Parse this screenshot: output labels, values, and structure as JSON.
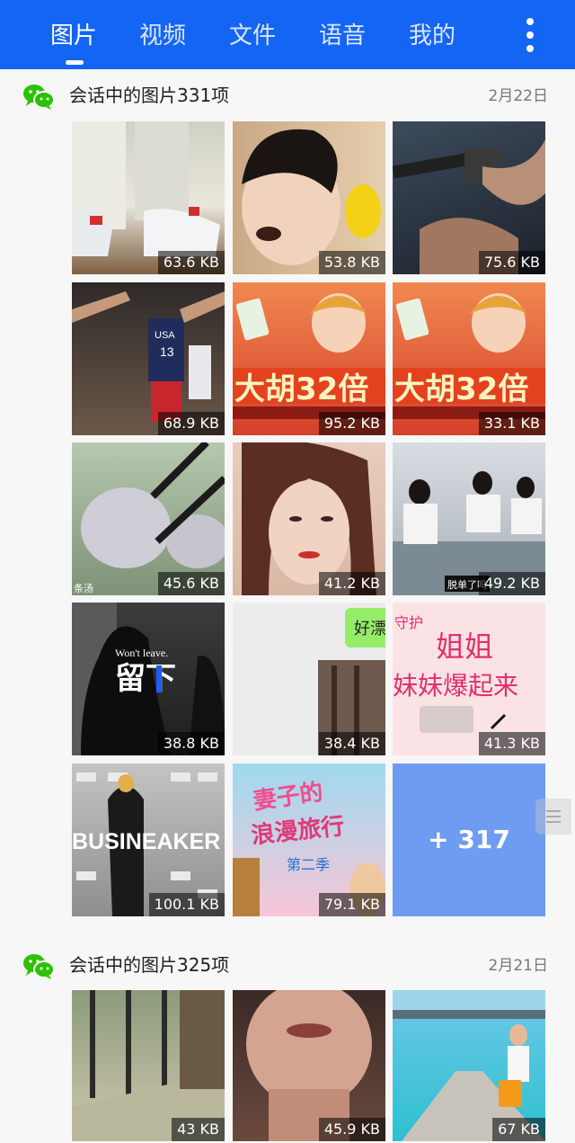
{
  "tabs": [
    {
      "label": "图片",
      "active": true
    },
    {
      "label": "视频",
      "active": false
    },
    {
      "label": "文件",
      "active": false
    },
    {
      "label": "语音",
      "active": false
    },
    {
      "label": "我的",
      "active": false
    }
  ],
  "colors": {
    "topbar": "#1565f5",
    "wechat_green": "#2dc100",
    "more_tile": "#6f9bf0"
  },
  "sections": [
    {
      "title": "会话中的图片331项",
      "date": "2月22日",
      "thumbnails": [
        {
          "size": "63.6 KB",
          "name": "sneakers-photo"
        },
        {
          "size": "53.8 KB",
          "name": "child-crying-photo"
        },
        {
          "size": "75.6 KB",
          "name": "rifle-photo"
        },
        {
          "size": "68.9 KB",
          "name": "basketball-photo",
          "overlay": "USA 13"
        },
        {
          "size": "95.2 KB",
          "name": "mahjong-ad",
          "overlay": "大胡32倍"
        },
        {
          "size": "33.1 KB",
          "name": "mahjong-ad-2",
          "overlay": "大胡32倍"
        },
        {
          "size": "45.6 KB",
          "name": "fishball-soup-photo",
          "overlay": "条汤"
        },
        {
          "size": "41.2 KB",
          "name": "woman-portrait-photo"
        },
        {
          "size": "49.2 KB",
          "name": "classroom-photo",
          "overlay": "脱单了吗"
        },
        {
          "size": "38.8 KB",
          "name": "wont-leave-photo",
          "overlay": "Won't leave.",
          "overlay2": "留下"
        },
        {
          "size": "38.4 KB",
          "name": "chat-screenshot",
          "overlay": "好漂"
        },
        {
          "size": "41.3 KB",
          "name": "sisters-poster",
          "overlay": "姐姐",
          "overlay2": "妹妹爆起来",
          "overlay3": "守护"
        },
        {
          "size": "100.1 KB",
          "name": "sneaker-store-photo",
          "overlay": "BUSINEAKER"
        },
        {
          "size": "79.1 KB",
          "name": "variety-show-poster",
          "overlay": "妻子的浪漫旅行",
          "overlay2": "第二季"
        }
      ],
      "more_count": "+ 317"
    },
    {
      "title": "会话中的图片325项",
      "date": "2月21日",
      "thumbnails": [
        {
          "size": "43 KB",
          "name": "stairs-photo"
        },
        {
          "size": "45.9 KB",
          "name": "face-closeup-photo"
        },
        {
          "size": "67 KB",
          "name": "beach-photo"
        }
      ]
    }
  ]
}
